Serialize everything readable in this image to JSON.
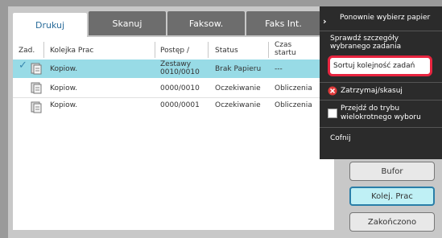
{
  "tabs": [
    {
      "label": "Drukuj"
    },
    {
      "label": "Skanuj"
    },
    {
      "label": "Faksow."
    },
    {
      "label": "Faks Int."
    }
  ],
  "table": {
    "headers": [
      "Zad.",
      "Kolejka Prac",
      "Postęp /",
      "Status",
      "Czas",
      "startu"
    ],
    "rows": [
      {
        "name": "Kopiow.",
        "progress_label": "Zestawy",
        "progress": "0010/0010",
        "status": "Brak Papieru",
        "start": "---"
      },
      {
        "name": "Kopiow.",
        "progress": "0000/0010",
        "status": "Oczekiwanie",
        "start": "Obliczenia"
      },
      {
        "name": "Kopiow.",
        "progress": "0000/0001",
        "status": "Oczekiwanie",
        "start": "Obliczenia"
      }
    ]
  },
  "menu": {
    "item1": "Ponownie wybierz papier",
    "item2_line1": "Sprawdź szczegóły",
    "item2_line2": "wybranego zadania",
    "item3": "Sortuj kolejność zadań",
    "item4": "Zatrzymaj/skasuj",
    "item5_line1": "Przejdź do trybu",
    "item5_line2": "wielokrotnego wyboru",
    "item6": "Cofnij"
  },
  "buttons": {
    "bufor": "Bufor",
    "kolej": "Kolej. Prac",
    "zakonczono": "Zakończono"
  },
  "colors": {
    "selected_row": "#98dbe6",
    "highlight_border": "#e8243f",
    "tab_active_text": "#2a6c9a"
  }
}
